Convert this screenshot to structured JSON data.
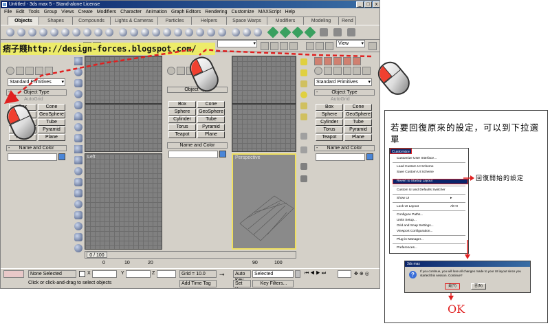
{
  "app": {
    "title": "Untitled - 3ds max 5 - Stand-alone License",
    "menu": [
      "File",
      "Edit",
      "Tools",
      "Group",
      "Views",
      "Create",
      "Modifiers",
      "Character",
      "Animation",
      "Graph Editors",
      "Rendering",
      "Customize",
      "MAXScript",
      "Help"
    ],
    "tabs": [
      "Objects",
      "Shapes",
      "Compounds",
      "Lights & Cameras",
      "Particles",
      "Helpers",
      "Space Warps",
      "Modifiers",
      "Modeling",
      "Rend"
    ],
    "active_tab": "Objects",
    "selection_dropdown": "View",
    "watermark": "痞子賤http://design-forces.blogspot.com/",
    "primitive_dropdown": "Standard Primitives",
    "object_type_rollout": "Object Type",
    "autogrid_label": "AutoGrid",
    "primitive_buttons": [
      "Box",
      "Cone",
      "Sphere",
      "GeoSphere",
      "Cylinder",
      "Tube",
      "Torus",
      "Pyramid",
      "Teapot",
      "Plane"
    ],
    "name_color_rollout": "Name and Color",
    "viewport_left_label": "Left",
    "viewport_persp_label": "Perspective",
    "time_slider": "0 / 100",
    "timeline_ticks": [
      "0",
      "10",
      "20",
      "90",
      "100"
    ],
    "status": {
      "selection": "None Selected",
      "prompt": "Click or click-and-drag to select objects",
      "x_label": "X",
      "y_label": "Y",
      "z_label": "Z",
      "grid": "Grid = 10.0",
      "add_time_tag": "Add Time Tag",
      "auto_key": "Auto Key",
      "set_key": "Set Key",
      "key_mode": "Selected",
      "key_filters": "Key Filters..."
    }
  },
  "guide": {
    "title": "若要回復原來的設定，可以到下拉選單",
    "menu_title": "Customize",
    "menu_items": [
      {
        "label": "Customize User Interface...",
        "shortcut": ""
      },
      {
        "label": "Load Custom UI Scheme",
        "shortcut": ""
      },
      {
        "label": "Save Custom UI Scheme",
        "shortcut": ""
      },
      {
        "label": "Revert to Startup Layout",
        "shortcut": ""
      },
      {
        "label": "Custom UI and Defaults Switcher",
        "shortcut": ""
      },
      {
        "label": "Show UI",
        "shortcut": "▸"
      },
      {
        "label": "Lock UI Layout",
        "shortcut": "Alt+0"
      },
      {
        "label": "Configure Paths...",
        "shortcut": ""
      },
      {
        "label": "Units Setup...",
        "shortcut": ""
      },
      {
        "label": "Grid and Snap Settings...",
        "shortcut": ""
      },
      {
        "label": "Viewport Configuration...",
        "shortcut": ""
      },
      {
        "label": "Plug-in Manager...",
        "shortcut": ""
      },
      {
        "label": "Preferences...",
        "shortcut": ""
      }
    ],
    "revert_label": "回復開始的設定",
    "dialog_title": "3ds max",
    "dialog_message": "If you continue, you will lose all changes made to your UI layout since you started this session. Continue?",
    "dialog_yes": "是(Y)",
    "dialog_no": "否(N)",
    "ok_label": "OK"
  },
  "colors": {
    "titlebar": "#0a246a",
    "panel": "#d4d0c8",
    "viewport_grid": "#808080",
    "watermark_bg": "#f0f060",
    "arrow_red": "#e02020"
  }
}
